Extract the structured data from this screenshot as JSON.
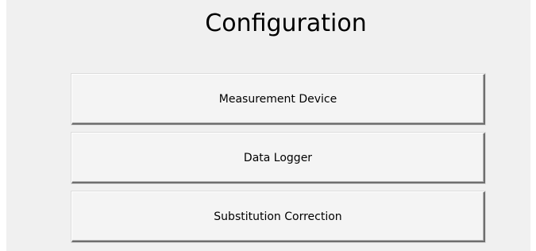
{
  "window": {
    "title": "Configuration"
  },
  "buttons": [
    {
      "label": "Measurement Device"
    },
    {
      "label": "Data Logger"
    },
    {
      "label": "Substitution Correction"
    }
  ],
  "colors": {
    "background": "#f0f0f0",
    "button_face": "#f4f4f4",
    "text": "#000000"
  }
}
